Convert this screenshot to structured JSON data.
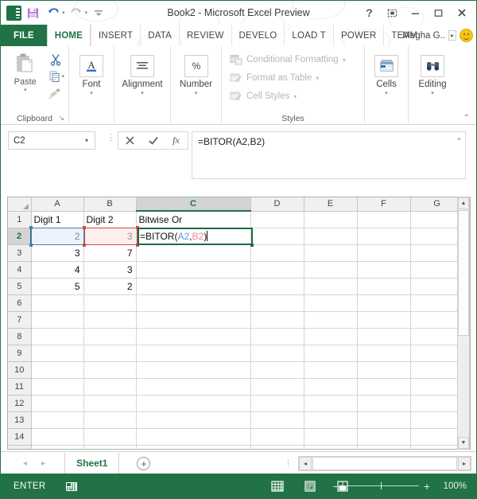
{
  "titlebar": {
    "document_title": "Book2 - Microsoft Excel Preview",
    "qat": [
      {
        "name": "excel-logo",
        "label": "XI"
      },
      {
        "name": "save-icon",
        "label": "Save"
      },
      {
        "name": "undo-icon",
        "label": "Undo"
      },
      {
        "name": "redo-icon",
        "label": "Redo"
      },
      {
        "name": "customize-qat-icon",
        "label": "Customize Quick Access Toolbar"
      }
    ],
    "window_controls": [
      {
        "name": "help-button",
        "glyph": "?"
      },
      {
        "name": "ribbon-display-options-button",
        "glyph": "⬚"
      },
      {
        "name": "minimize-button",
        "glyph": "—"
      },
      {
        "name": "maximize-button",
        "glyph": "❐"
      },
      {
        "name": "close-button",
        "glyph": "✕"
      }
    ]
  },
  "ribbon_tabs": {
    "file": "FILE",
    "tabs": [
      "HOME",
      "INSERT",
      "DATA",
      "REVIEW",
      "DEVELO",
      "LOAD T",
      "POWER",
      "TEAM"
    ],
    "active_tab": "HOME",
    "user_name": "Megha G..",
    "user_arrow": "▸"
  },
  "ribbon": {
    "clipboard": {
      "group_label": "Clipboard",
      "paste_label": "Paste",
      "caret": "▾",
      "items": [
        "cut-icon",
        "copy-icon",
        "format-painter-icon"
      ],
      "dialog_launcher": "↘"
    },
    "font": {
      "label": "Font",
      "caret": "▾",
      "icon": "A"
    },
    "alignment": {
      "label": "Alignment",
      "caret": "▾",
      "icon": "align-center-icon"
    },
    "number": {
      "label": "Number",
      "caret": "▾",
      "icon": "%"
    },
    "styles": {
      "group_label": "Styles",
      "items": [
        {
          "label": "Conditional Formatting",
          "icon": "conditional-formatting-icon",
          "caret": "▾"
        },
        {
          "label": "Format as Table",
          "icon": "format-as-table-icon",
          "caret": "▾"
        },
        {
          "label": "Cell Styles",
          "icon": "cell-styles-icon",
          "caret": "▾"
        }
      ]
    },
    "cells": {
      "label": "Cells",
      "caret": "▾",
      "icon": "cells-icon"
    },
    "editing": {
      "label": "Editing",
      "caret": "▾",
      "icon": "binoculars-icon"
    },
    "collapse": "⌃"
  },
  "formula_bar": {
    "name_box_value": "C2",
    "name_box_caret": "▾",
    "cancel_glyph": "✕",
    "enter_glyph": "✓",
    "fx_label": "fx",
    "formula_value": "=BITOR(A2,B2)",
    "expand_glyph": "⌃"
  },
  "grid": {
    "columns": [
      "A",
      "B",
      "C",
      "D",
      "E",
      "F",
      "G"
    ],
    "selected_column": "C",
    "rows": [
      "1",
      "2",
      "3",
      "4",
      "5",
      "6",
      "7",
      "8",
      "9",
      "10",
      "11",
      "12",
      "13",
      "14"
    ],
    "selected_row": "2",
    "cells": {
      "A1": "Digit 1",
      "B1": "Digit 2",
      "C1": "Bitwise Or",
      "A2": "2",
      "B2": "3",
      "A3": "3",
      "B3": "7",
      "A4": "4",
      "B4": "3",
      "A5": "5",
      "B5": "2"
    },
    "editing_cell": "C2",
    "editing_text_prefix": "=BITOR(",
    "editing_ref_a": "A2",
    "editing_ref_sep": ",",
    "editing_ref_b": "B2",
    "editing_text_suffix": ")",
    "colors": {
      "ref_a": "#5b9bd5",
      "ref_b": "#e08b8b",
      "selection_a": "#4a7ebb",
      "selection_b": "#d04a3f",
      "selection_c": "#1d6b42"
    }
  },
  "sheet_bar": {
    "prev_glyph": "◂",
    "next_glyph": "▸",
    "sheets": [
      "Sheet1"
    ],
    "active_sheet": "Sheet1",
    "add_sheet_glyph": "+",
    "scroll_left_glyph": "◂",
    "scroll_right_glyph": "▸"
  },
  "status_bar": {
    "mode": "ENTER",
    "macro_record_icon": "record-macro-icon",
    "views": [
      {
        "name": "normal-view-button",
        "label": "Normal"
      },
      {
        "name": "page-layout-view-button",
        "label": "Page Layout"
      },
      {
        "name": "page-break-preview-button",
        "label": "Page Break Preview"
      }
    ],
    "zoom_minus": "−",
    "zoom_plus": "+",
    "zoom_level": "100%"
  },
  "theme": {
    "accent_green": "#217346",
    "ribbon_bg": "#ffffff",
    "grid_line": "#d6d6d6",
    "header_bg": "#f0f0f0"
  }
}
